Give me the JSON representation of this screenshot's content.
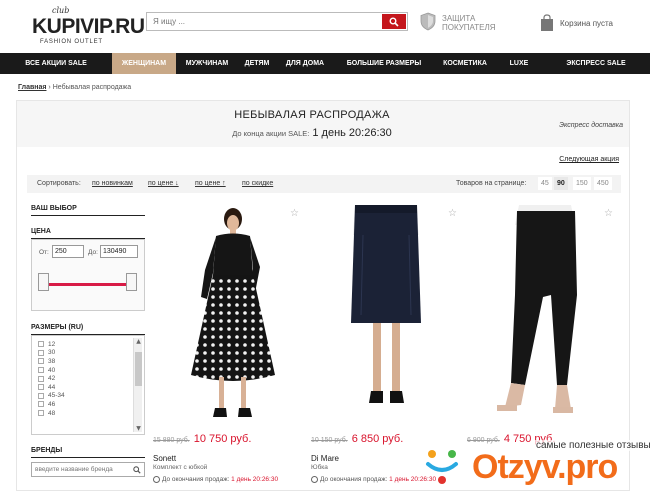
{
  "header": {
    "logo_club": "club",
    "logo_brand": "KUPIVIP.RU",
    "logo_tag": "FASHION OUTLET",
    "search_placeholder": "Я ищу ...",
    "protect_text": "ЗАЩИТА ПОКУПАТЕЛЯ",
    "cart_text": "Корзина пуста"
  },
  "nav": [
    {
      "label": "ВСЕ АКЦИИ SALE"
    },
    {
      "label": "ЖЕНЩИНАМ"
    },
    {
      "label": "МУЖЧИНАМ"
    },
    {
      "label": "ДЕТЯМ"
    },
    {
      "label": "ДЛЯ ДОМА"
    },
    {
      "label": "БОЛЬШИЕ РАЗМЕРЫ"
    },
    {
      "label": "КОСМЕТИКА"
    },
    {
      "label": "LUXE"
    },
    {
      "label": "ЭКСПРЕСС SALE"
    }
  ],
  "breadcrumb": {
    "home": "Главная",
    "sep": " › ",
    "current": "Небывалая распродажа"
  },
  "sale": {
    "title": "НЕБЫВАЛАЯ РАСПРОДАЖА",
    "countdown_label": "До конца акции SALE:",
    "countdown_value": "1 день 20:26:30",
    "express": "Экспресс доставка",
    "next_sale": "Следующая акция"
  },
  "sort": {
    "label": "Сортировать:",
    "options": [
      "по новинкам",
      "по цене ↓",
      "по цене ↑",
      "по скидке"
    ],
    "per_page_label": "Товаров на странице:",
    "per_page": [
      "45",
      "90",
      "150",
      "450"
    ],
    "per_page_selected": "90"
  },
  "filters": {
    "your_choice": "ВАШ ВЫБОР",
    "price_title": "ЦЕНА",
    "price_from_label": "От:",
    "price_from": "250",
    "price_to_label": "До:",
    "price_to": "130490",
    "sizes_title": "РАЗМЕРЫ (RU)",
    "sizes": [
      "12",
      "30",
      "38",
      "40",
      "42",
      "44",
      "45-34",
      "46",
      "48"
    ],
    "brands_title": "БРЕНДЫ",
    "brand_placeholder": "введите название бренда"
  },
  "products": [
    {
      "old_price": "15 880 руб.",
      "new_price": "10 750 руб.",
      "brand": "Sonett",
      "desc": "Комплект с юбкой",
      "till_label": "До окончания продаж:",
      "till_value": "1 день 20:26:30"
    },
    {
      "old_price": "10 150 руб.",
      "new_price": "6 850 руб.",
      "brand": "Di Mare",
      "desc": "Юбка",
      "till_label": "До окончания продаж:",
      "till_value": "1 день 20:26:30"
    },
    {
      "old_price": "6 900 руб.",
      "new_price": "4 750 руб.",
      "brand": "",
      "desc": "",
      "till_label": "",
      "till_value": ""
    }
  ],
  "watermark": {
    "text": "самые полезные отзывы",
    "logo": "Otzyv.pro"
  }
}
